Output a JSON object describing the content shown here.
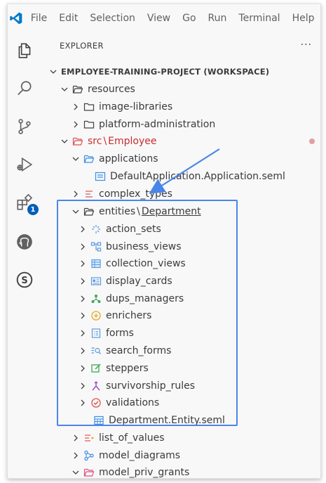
{
  "menu": [
    "File",
    "Edit",
    "Selection",
    "View",
    "Go",
    "Run",
    "Terminal",
    "Help"
  ],
  "activity": {
    "source_control_badge": "1"
  },
  "explorer": {
    "title": "EXPLORER",
    "more": "···",
    "workspace": "EMPLOYEE-TRAINING-PROJECT (WORKSPACE)",
    "tree": {
      "resources": "resources",
      "image_libraries": "image-libraries",
      "platform_administration": "platform-administration",
      "src": "src",
      "src_sep": "\\",
      "src_child": "Employee",
      "applications": "applications",
      "default_application": "DefaultApplication.Application.seml",
      "complex_types": "complex_types",
      "entities": "entities",
      "entities_sep": "\\",
      "entities_child": "Department",
      "action_sets": "action_sets",
      "business_views": "business_views",
      "collection_views": "collection_views",
      "display_cards": "display_cards",
      "dups_managers": "dups_managers",
      "enrichers": "enrichers",
      "forms": "forms",
      "search_forms": "search_forms",
      "steppers": "steppers",
      "survivorship_rules": "survivorship_rules",
      "validations": "validations",
      "department_entity": "Department.Entity.seml",
      "list_of_values": "list_of_values",
      "model_diagrams": "model_diagrams",
      "model_priv_grants": "model_priv_grants"
    }
  },
  "colors": {
    "accent": "#005fb8",
    "highlight": "#4a86e8",
    "error_red": "#c72e2e"
  }
}
